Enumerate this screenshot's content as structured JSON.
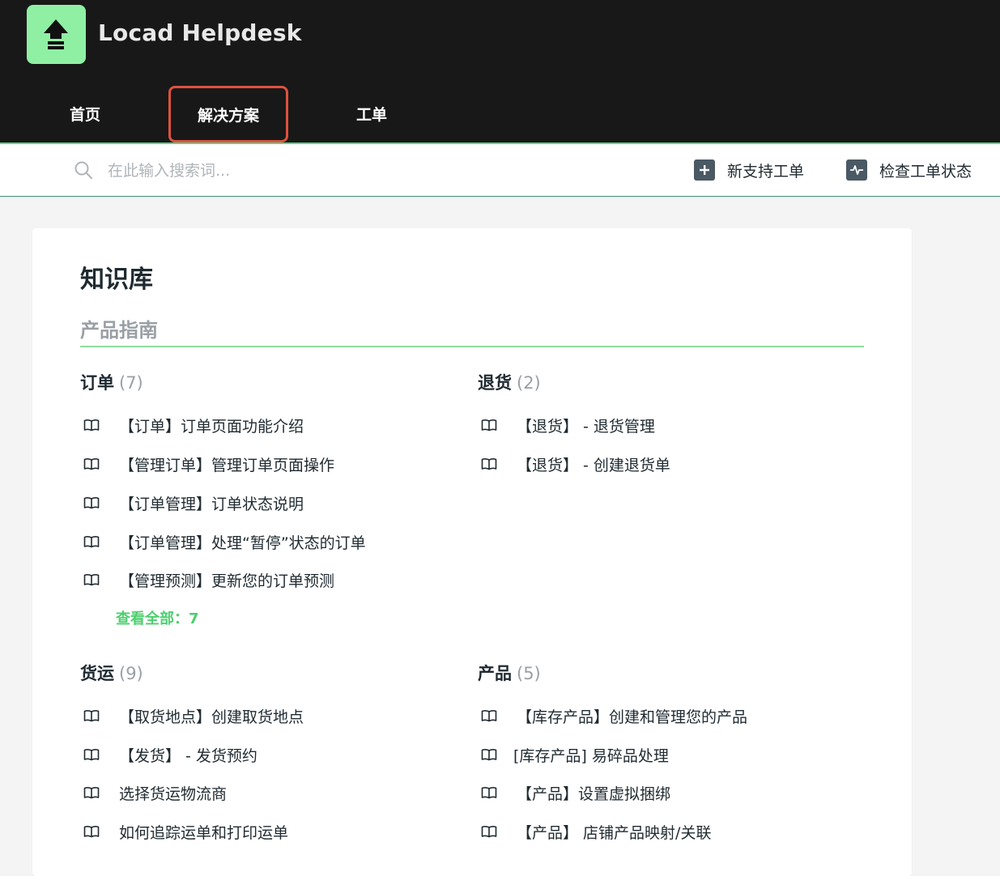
{
  "header": {
    "brand": "Locad Helpdesk",
    "nav": [
      {
        "label": "首页"
      },
      {
        "label": "解决方案"
      },
      {
        "label": "工单"
      }
    ]
  },
  "search": {
    "placeholder": "在此输入搜索词...",
    "actions": [
      {
        "label": "新支持工单",
        "icon": "plus-square-icon"
      },
      {
        "label": "检查工单状态",
        "icon": "activity-icon"
      }
    ]
  },
  "knowledge_base": {
    "title": "知识库",
    "section_title": "产品指南",
    "categories": [
      {
        "title": "订单",
        "count": "(7)",
        "articles": [
          "【订单】订单页面功能介绍",
          "【管理订单】管理订单页面操作",
          "【订单管理】订单状态说明",
          "【订单管理】处理“暂停”状态的订单",
          "【管理预测】更新您的订单预测"
        ],
        "view_all": "查看全部：7"
      },
      {
        "title": "退货",
        "count": "(2)",
        "articles": [
          "【退货】 - 退货管理",
          "【退货】 - 创建退货单"
        ]
      },
      {
        "title": "货运",
        "count": "(9)",
        "articles": [
          "【取货地点】创建取货地点",
          "【发货】 - 发货预约",
          "选择货运物流商",
          "如何追踪运单和打印运单"
        ]
      },
      {
        "title": "产品",
        "count": "(5)",
        "articles": [
          "【库存产品】创建和管理您的产品",
          "[库存产品] 易碎品处理",
          "【产品】设置虚拟捆绑",
          "【产品】 店铺产品映射/关联"
        ]
      }
    ]
  },
  "colors": {
    "header_bg": "#181818",
    "logo_bg": "#8ff0a4",
    "accent_green": "#4ccf6e",
    "active_nav_border": "#e0513e"
  }
}
